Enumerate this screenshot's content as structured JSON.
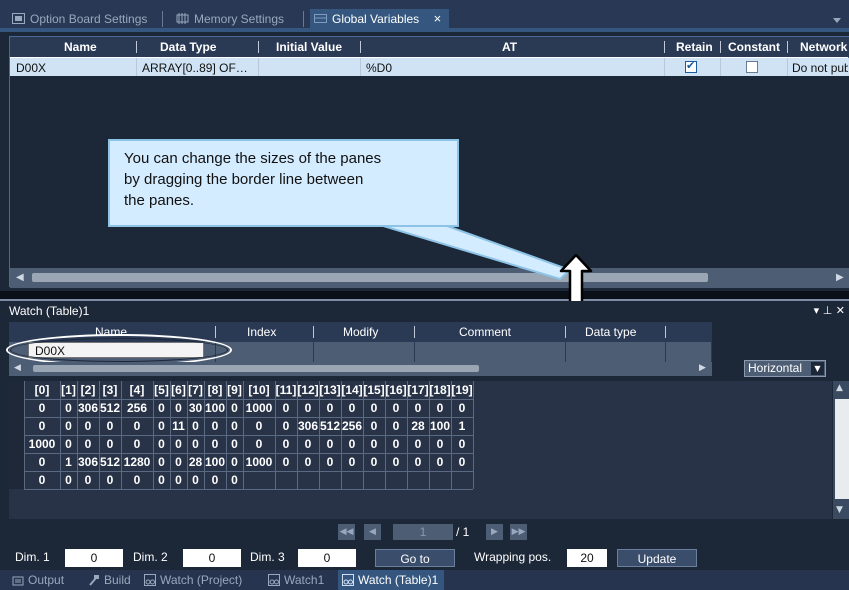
{
  "tabs": [
    {
      "label": "Option Board Settings",
      "icon": "board-icon"
    },
    {
      "label": "Memory Settings",
      "icon": "memory-icon"
    },
    {
      "label": "Global Variables",
      "icon": "variables-icon",
      "active": true
    }
  ],
  "tab_close": "×",
  "global_vars": {
    "columns": [
      "Name",
      "Data Type",
      "Initial Value",
      "AT",
      "Retain",
      "Constant",
      "Network"
    ],
    "rows": [
      {
        "name": "D00X",
        "data_type": "ARRAY[0..89] OF…",
        "initial_value": "",
        "at": "%D0",
        "retain": true,
        "constant": false,
        "network": "Do not publi"
      }
    ]
  },
  "callout": {
    "line1": "You can change the sizes of the panes",
    "line2": "by dragging the border line between",
    "line3": "the panes."
  },
  "watch": {
    "title": "Watch (Table)1",
    "pin_controls": "▾ ⊥ ✕",
    "columns": [
      "Name",
      "Index",
      "Modify",
      "Comment",
      "Data type"
    ],
    "name_value": "D00X",
    "orientation": "Horizontal",
    "array_headers": [
      "[0]",
      "[1]",
      "[2]",
      "[3]",
      "[4]",
      "[5]",
      "[6]",
      "[7]",
      "[8]",
      "[9]",
      "[10]",
      "[11]",
      "[12]",
      "[13]",
      "[14]",
      "[15]",
      "[16]",
      "[17]",
      "[18]",
      "[19]"
    ],
    "array_rows": [
      [
        "0",
        "0",
        "306",
        "512",
        "256",
        "0",
        "0",
        "30",
        "100",
        "0",
        "1000",
        "0",
        "0",
        "0",
        "0",
        "0",
        "0",
        "0",
        "0",
        "0"
      ],
      [
        "0",
        "0",
        "0",
        "0",
        "0",
        "0",
        "11",
        "0",
        "0",
        "0",
        "0",
        "0",
        "306",
        "512",
        "256",
        "0",
        "0",
        "28",
        "100",
        "1"
      ],
      [
        "1000",
        "0",
        "0",
        "0",
        "0",
        "0",
        "0",
        "0",
        "0",
        "0",
        "0",
        "0",
        "0",
        "0",
        "0",
        "0",
        "0",
        "0",
        "0",
        "0"
      ],
      [
        "0",
        "1",
        "306",
        "512",
        "1280",
        "0",
        "0",
        "28",
        "100",
        "0",
        "1000",
        "0",
        "0",
        "0",
        "0",
        "0",
        "0",
        "0",
        "0",
        "0"
      ],
      [
        "0",
        "0",
        "0",
        "0",
        "0",
        "0",
        "0",
        "0",
        "0",
        "0",
        "",
        "",
        "",
        "",
        "",
        "",
        "",
        "",
        "",
        ""
      ]
    ],
    "page_current": "1",
    "page_total": "/ 1",
    "dim1_label": "Dim. 1",
    "dim1_value": "0",
    "dim2_label": "Dim. 2",
    "dim2_value": "0",
    "dim3_label": "Dim. 3",
    "dim3_value": "0",
    "goto_label": "Go to",
    "wrap_label": "Wrapping pos.",
    "wrap_value": "20",
    "update_label": "Update"
  },
  "bottom_tabs": [
    {
      "label": "Output",
      "icon": "output-icon"
    },
    {
      "label": "Build",
      "icon": "build-icon"
    },
    {
      "label": "Watch (Project)",
      "icon": "watch-icon"
    },
    {
      "label": "Watch1",
      "icon": "watch-icon"
    },
    {
      "label": "Watch (Table)1",
      "icon": "watch-icon",
      "active": true
    }
  ],
  "colors": {
    "background": "#1c2738",
    "active_tab": "#35577f",
    "callout_bg": "#d4ecff",
    "selected_row": "#cfe3f5"
  }
}
